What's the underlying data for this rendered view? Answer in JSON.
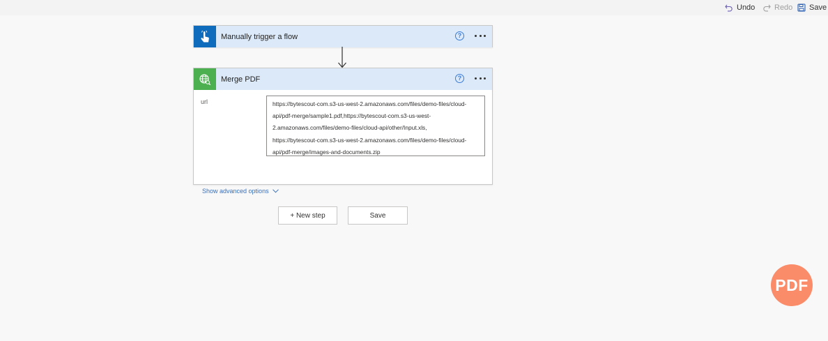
{
  "toolbar": {
    "undo_label": "Undo",
    "redo_label": "Redo",
    "save_label": "Save"
  },
  "trigger_card": {
    "title": "Manually trigger a flow",
    "icon": "hand-pointer-icon",
    "header_color": "#dbe9f8",
    "icon_bg": "#0f6cbd"
  },
  "merge_card": {
    "title": "Merge PDF",
    "icon": "globe-icon",
    "icon_bg": "#4caf50",
    "url_label": "url",
    "url_lines": [
      "https://bytescout-com.s3-us-west-2.amazonaws.com/files/demo-files/cloud-",
      "api/pdf-merge/sample1.pdf,https://bytescout-com.s3-us-west-",
      "2.amazonaws.com/files/demo-files/cloud-api/other/Input.xls,",
      "https://bytescout-com.s3-us-west-2.amazonaws.com/files/demo-files/cloud-",
      "api/pdf-merge/images-and-documents.zip"
    ],
    "advanced_label": "Show advanced options"
  },
  "actions": {
    "new_step_label": "+ New step",
    "save_label": "Save"
  },
  "badge": {
    "text": "PDF",
    "color": "#fb8c69"
  }
}
